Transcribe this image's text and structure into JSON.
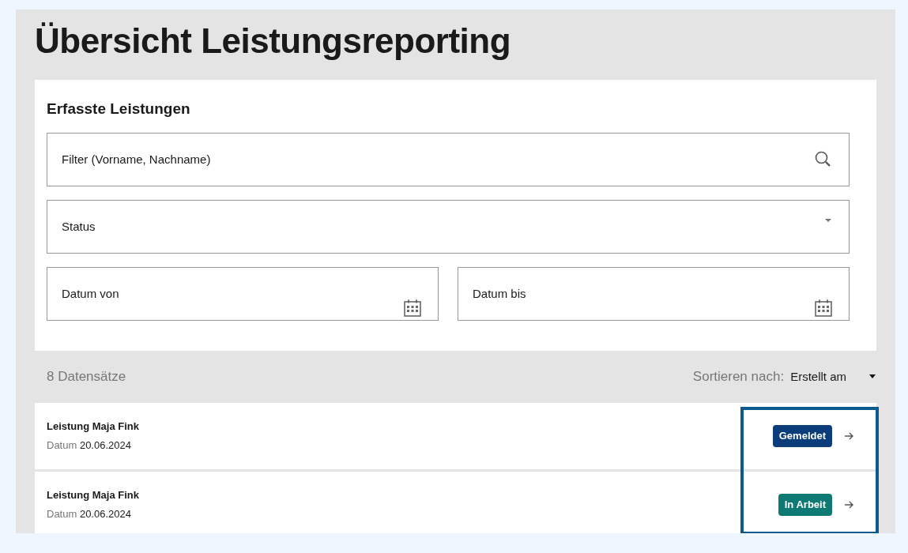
{
  "title": "Übersicht Leistungsreporting",
  "filter_card": {
    "heading": "Erfasste Leistungen",
    "search": {
      "placeholder": "Filter (Vorname, Nachname)"
    },
    "status_select": {
      "placeholder": "Status"
    },
    "date_from": {
      "placeholder": "Datum von"
    },
    "date_to": {
      "placeholder": "Datum bis"
    }
  },
  "result_count": "8 Datensätze",
  "sort": {
    "label": "Sortieren nach:",
    "value": "Erstellt am"
  },
  "records": [
    {
      "title": "Leistung Maja Fink",
      "date_label": "Datum",
      "date": "20.06.2024",
      "status": "Gemeldet",
      "color": "#0b3d7a"
    },
    {
      "title": "Leistung Maja Fink",
      "date_label": "Datum",
      "date": "20.06.2024",
      "status": "In Arbeit",
      "color": "#0f7a74"
    }
  ]
}
